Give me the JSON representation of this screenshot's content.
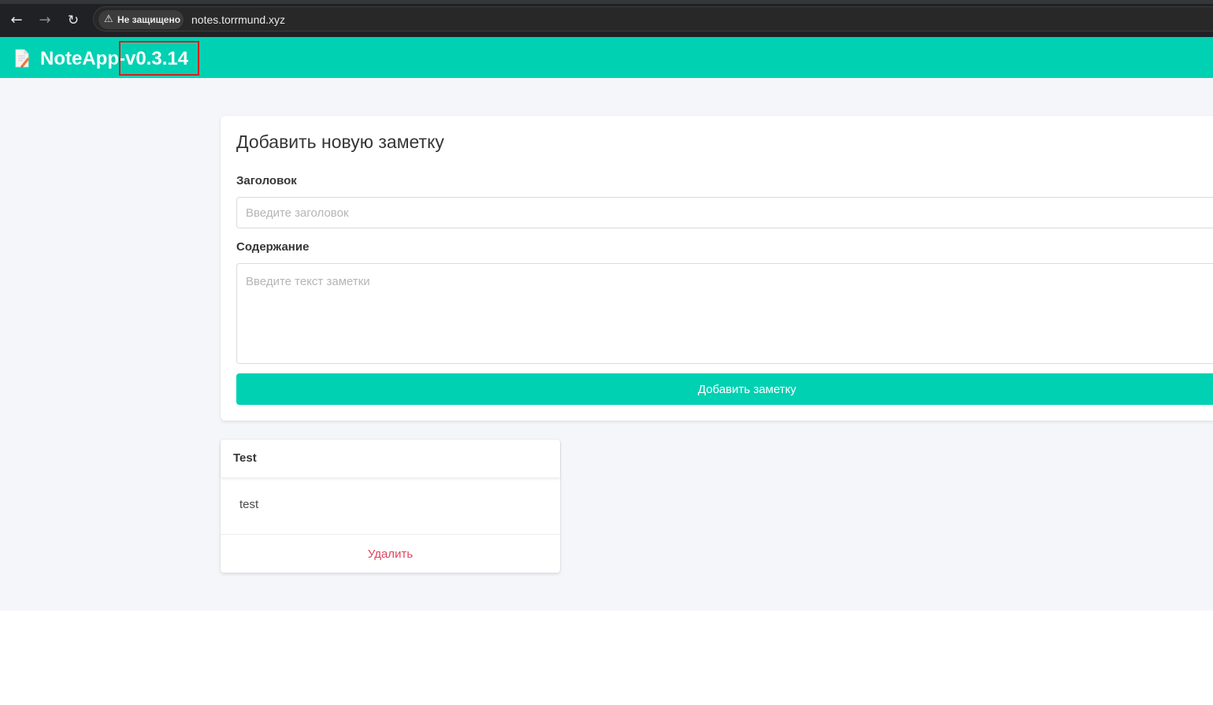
{
  "browser": {
    "back_icon": "←",
    "forward_icon": "→",
    "reload_icon": "↻",
    "security_warning_icon": "⚠",
    "security_label": "Не защищено",
    "url": "notes.torrmund.xyz"
  },
  "header": {
    "brand": "NoteApp-v0.3.14",
    "logo_icon": "notepad-icon",
    "accent_color": "#00d1b2"
  },
  "form": {
    "title": "Добавить новую заметку",
    "title_label": "Заголовок",
    "title_placeholder": "Введите заголовок",
    "title_value": "",
    "content_label": "Содержание",
    "content_placeholder": "Введите текст заметки",
    "content_value": "",
    "submit_label": "Добавить заметку"
  },
  "notes": [
    {
      "title": "Test",
      "body": "test",
      "delete_label": "Удалить"
    }
  ]
}
